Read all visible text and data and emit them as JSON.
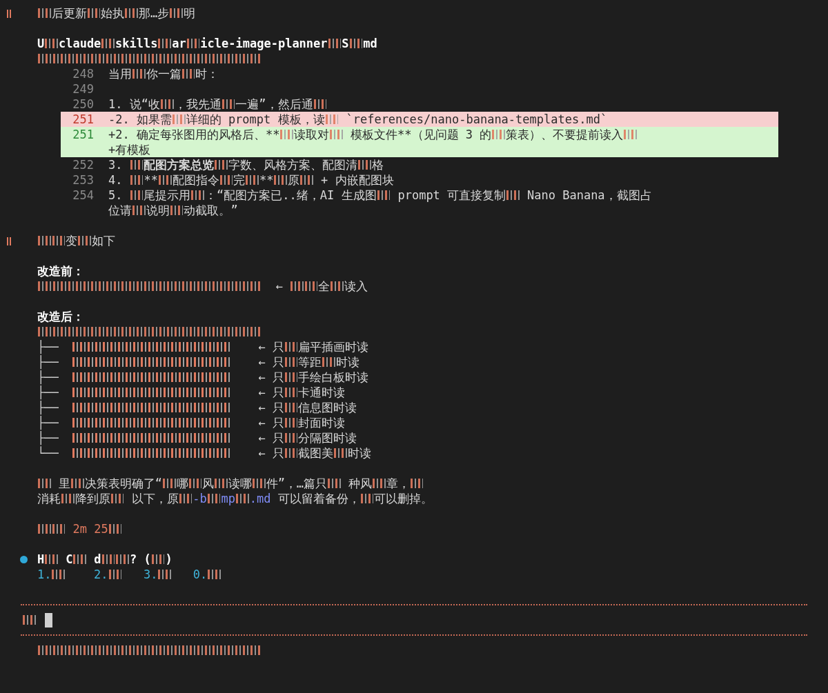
{
  "lines": [
    {
      "kind": "message",
      "segs": [
        {
          "kind": "glitch"
        },
        {
          "kind": "text",
          "text": "后更新"
        },
        {
          "kind": "glitch"
        },
        {
          "kind": "text",
          "text": "始执"
        },
        {
          "kind": "glitch"
        },
        {
          "kind": "text",
          "text": "那…步"
        },
        {
          "kind": "glitch"
        },
        {
          "kind": "text",
          "text": "明"
        }
      ]
    },
    {
      "kind": "blank"
    },
    {
      "kind": "header",
      "segs": [
        {
          "kind": "bold",
          "text": "U"
        },
        {
          "kind": "glitch"
        },
        {
          "kind": "bold",
          "text": "claude"
        },
        {
          "kind": "glitch"
        },
        {
          "kind": "bold",
          "text": "skills"
        },
        {
          "kind": "glitch"
        },
        {
          "kind": "bold",
          "text": "ar"
        },
        {
          "kind": "glitch"
        },
        {
          "kind": "bold",
          "text": "icle-image-planner"
        },
        {
          "kind": "glitch"
        },
        {
          "kind": "bold",
          "text": "S"
        },
        {
          "kind": "glitch"
        },
        {
          "kind": "bold",
          "text": "md"
        }
      ]
    },
    {
      "kind": "plain",
      "segs": [
        {
          "kind": "glitch-run"
        }
      ]
    },
    {
      "kind": "code",
      "number": "248",
      "segs": [
        {
          "kind": "text",
          "text": "当用"
        },
        {
          "kind": "glitch"
        },
        {
          "kind": "text",
          "text": "你一篇"
        },
        {
          "kind": "glitch"
        },
        {
          "kind": "text",
          "text": "时："
        }
      ]
    },
    {
      "kind": "code",
      "number": "249"
    },
    {
      "kind": "code",
      "number": "250",
      "segs": [
        {
          "kind": "text",
          "text": "1. 说“收"
        },
        {
          "kind": "glitch"
        },
        {
          "kind": "text",
          "text": "，我先通"
        },
        {
          "kind": "glitch"
        },
        {
          "kind": "text",
          "text": "一遍”，然后通"
        },
        {
          "kind": "glitch"
        }
      ]
    },
    {
      "kind": "removed",
      "number": "251",
      "segs": [
        {
          "kind": "text",
          "text": "-2. 如果需"
        },
        {
          "kind": "glitch"
        },
        {
          "kind": "text",
          "text": "详细的 prompt 模板，读"
        },
        {
          "kind": "glitch"
        },
        {
          "kind": "text",
          "text": " `references/nano-banana-templates.md`"
        }
      ]
    },
    {
      "kind": "added",
      "number": "251",
      "segs": [
        {
          "kind": "text",
          "text": "+2. 确定每张图用的风格后、**"
        },
        {
          "kind": "glitch"
        },
        {
          "kind": "text",
          "text": "读取对"
        },
        {
          "kind": "glitch"
        },
        {
          "kind": "text",
          "text": " 模板文件**（见问题 3 的"
        },
        {
          "kind": "glitch"
        },
        {
          "kind": "text",
          "text": "策表）、不要提前读入"
        },
        {
          "kind": "glitch"
        }
      ]
    },
    {
      "kind": "added",
      "segs": [
        {
          "kind": "text",
          "text": "+有模板"
        }
      ]
    },
    {
      "kind": "code",
      "number": "252",
      "segs": [
        {
          "kind": "text",
          "text": "3. "
        },
        {
          "kind": "glitch"
        },
        {
          "kind": "text",
          "text": "**配图方案总览**"
        },
        {
          "kind": "glitch"
        },
        {
          "kind": "text",
          "text": "字数、风格方案、配图清"
        },
        {
          "kind": "glitch"
        },
        {
          "kind": "text",
          "text": "格"
        }
      ]
    },
    {
      "kind": "code",
      "number": "253",
      "segs": [
        {
          "kind": "text",
          "text": "4. "
        },
        {
          "kind": "glitch"
        },
        {
          "kind": "text",
          "text": "**"
        },
        {
          "kind": "glitch"
        },
        {
          "kind": "text",
          "text": "配图指令"
        },
        {
          "kind": "glitch"
        },
        {
          "kind": "text",
          "text": "完"
        },
        {
          "kind": "glitch"
        },
        {
          "kind": "text",
          "text": "**"
        },
        {
          "kind": "glitch"
        },
        {
          "kind": "text",
          "text": "原"
        },
        {
          "kind": "glitch"
        },
        {
          "kind": "text",
          "text": " + 内嵌配图块"
        }
      ]
    },
    {
      "kind": "code",
      "number": "254",
      "segs": [
        {
          "kind": "text",
          "text": "5. "
        },
        {
          "kind": "glitch"
        },
        {
          "kind": "text",
          "text": "尾提示用"
        },
        {
          "kind": "glitch"
        },
        {
          "kind": "text",
          "text": "：“配图方案已..绪，AI 生成图"
        },
        {
          "kind": "glitch"
        },
        {
          "kind": "text",
          "text": " prompt 可直接复制"
        },
        {
          "kind": "glitch"
        },
        {
          "kind": "text",
          "text": " Nano Banana，截图占"
        }
      ]
    },
    {
      "kind": "code",
      "segs": [
        {
          "kind": "text",
          "text": "位请"
        },
        {
          "kind": "glitch"
        },
        {
          "kind": "text",
          "text": "说明"
        },
        {
          "kind": "glitch"
        },
        {
          "kind": "text",
          "text": "动截取。”"
        }
      ]
    },
    {
      "kind": "blank"
    },
    {
      "kind": "message",
      "segs": [
        {
          "kind": "glitch"
        },
        {
          "kind": "glitch"
        },
        {
          "kind": "text",
          "text": "变"
        },
        {
          "kind": "glitch"
        },
        {
          "kind": "text",
          "text": "如下"
        }
      ]
    },
    {
      "kind": "blank"
    },
    {
      "kind": "plain",
      "segs": [
        {
          "kind": "bold",
          "text": "改造前："
        }
      ]
    },
    {
      "kind": "plain",
      "segs": [
        {
          "kind": "glitch-run"
        },
        {
          "kind": "text",
          "text": "  ← "
        },
        {
          "kind": "glitch"
        },
        {
          "kind": "glitch"
        },
        {
          "kind": "text",
          "text": "全"
        },
        {
          "kind": "glitch"
        },
        {
          "kind": "text",
          "text": "读入"
        }
      ]
    },
    {
      "kind": "blank"
    },
    {
      "kind": "plain",
      "segs": [
        {
          "kind": "bold",
          "text": "改造后："
        }
      ]
    },
    {
      "kind": "plain",
      "segs": [
        {
          "kind": "glitch-run"
        }
      ]
    },
    {
      "kind": "tree",
      "branch": "├──",
      "segs": [
        {
          "kind": "text",
          "text": "← 只"
        },
        {
          "kind": "glitch"
        },
        {
          "kind": "text",
          "text": "扁平插画时读"
        }
      ]
    },
    {
      "kind": "tree",
      "branch": "├──",
      "segs": [
        {
          "kind": "text",
          "text": "← 只"
        },
        {
          "kind": "glitch"
        },
        {
          "kind": "text",
          "text": "等距"
        },
        {
          "kind": "glitch"
        },
        {
          "kind": "text",
          "text": "时读"
        }
      ]
    },
    {
      "kind": "tree",
      "branch": "├──",
      "segs": [
        {
          "kind": "text",
          "text": "← 只"
        },
        {
          "kind": "glitch"
        },
        {
          "kind": "text",
          "text": "手绘白板时读"
        }
      ]
    },
    {
      "kind": "tree",
      "branch": "├──",
      "segs": [
        {
          "kind": "text",
          "text": "← 只"
        },
        {
          "kind": "glitch"
        },
        {
          "kind": "text",
          "text": "卡通时读"
        }
      ]
    },
    {
      "kind": "tree",
      "branch": "├──",
      "segs": [
        {
          "kind": "text",
          "text": "← 只"
        },
        {
          "kind": "glitch"
        },
        {
          "kind": "text",
          "text": "信息图时读"
        }
      ]
    },
    {
      "kind": "tree",
      "branch": "├──",
      "segs": [
        {
          "kind": "text",
          "text": "← 只"
        },
        {
          "kind": "glitch"
        },
        {
          "kind": "text",
          "text": "封面时读"
        }
      ]
    },
    {
      "kind": "tree",
      "branch": "├──",
      "segs": [
        {
          "kind": "text",
          "text": "← 只"
        },
        {
          "kind": "glitch"
        },
        {
          "kind": "text",
          "text": "分隔图时读"
        }
      ]
    },
    {
      "kind": "tree",
      "branch": "└──",
      "segs": [
        {
          "kind": "text",
          "text": "← 只"
        },
        {
          "kind": "glitch"
        },
        {
          "kind": "text",
          "text": "截图美"
        },
        {
          "kind": "glitch"
        },
        {
          "kind": "text",
          "text": "时读"
        }
      ]
    },
    {
      "kind": "blank"
    },
    {
      "kind": "plain",
      "segs": [
        {
          "kind": "glitch"
        },
        {
          "kind": "text",
          "text": " 里"
        },
        {
          "kind": "glitch"
        },
        {
          "kind": "text",
          "text": "决策表明确了“"
        },
        {
          "kind": "glitch"
        },
        {
          "kind": "text",
          "text": "哪"
        },
        {
          "kind": "glitch"
        },
        {
          "kind": "text",
          "text": "风"
        },
        {
          "kind": "glitch"
        },
        {
          "kind": "text",
          "text": "读哪"
        },
        {
          "kind": "glitch"
        },
        {
          "kind": "text",
          "text": "件”，…篇只"
        },
        {
          "kind": "glitch"
        },
        {
          "kind": "text",
          "text": " 种风"
        },
        {
          "kind": "glitch"
        },
        {
          "kind": "text",
          "text": "章，"
        },
        {
          "kind": "glitch"
        }
      ]
    },
    {
      "kind": "plain",
      "segs": [
        {
          "kind": "text",
          "text": "消耗"
        },
        {
          "kind": "glitch"
        },
        {
          "kind": "text",
          "text": "降到原"
        },
        {
          "kind": "glitch"
        },
        {
          "kind": "text",
          "text": " 以下，原"
        },
        {
          "kind": "glitch"
        },
        {
          "kind": "link",
          "text": "-b"
        },
        {
          "kind": "glitch"
        },
        {
          "kind": "link",
          "text": "mp"
        },
        {
          "kind": "glitch"
        },
        {
          "kind": "link",
          "text": ".md"
        },
        {
          "kind": "text",
          "text": " 可以留着备份，"
        },
        {
          "kind": "glitch"
        },
        {
          "kind": "text",
          "text": "可以删掉。"
        }
      ]
    },
    {
      "kind": "blank"
    },
    {
      "kind": "timer",
      "segs": [
        {
          "kind": "glitch"
        },
        {
          "kind": "glitch"
        },
        {
          "kind": "warm",
          "text": " 2m 25"
        },
        {
          "kind": "glitch"
        }
      ]
    },
    {
      "kind": "blank"
    },
    {
      "kind": "question",
      "segs": [
        {
          "kind": "bold",
          "text": "H"
        },
        {
          "kind": "glitch"
        },
        {
          "kind": "bold",
          "text": " C"
        },
        {
          "kind": "glitch"
        },
        {
          "kind": "bold",
          "text": " d"
        },
        {
          "kind": "glitch"
        },
        {
          "kind": "glitch"
        },
        {
          "kind": "bold",
          "text": "? ("
        },
        {
          "kind": "glitch"
        },
        {
          "kind": "bold",
          "text": ")"
        }
      ]
    },
    {
      "kind": "plain",
      "segs": [
        {
          "kind": "option",
          "text": "1."
        },
        {
          "kind": "glitch"
        },
        {
          "kind": "option",
          "text": "    2."
        },
        {
          "kind": "glitch"
        },
        {
          "kind": "option",
          "text": "   3."
        },
        {
          "kind": "glitch"
        },
        {
          "kind": "option",
          "text": "   0."
        },
        {
          "kind": "glitch"
        }
      ]
    },
    {
      "kind": "blank"
    },
    {
      "kind": "rule"
    },
    {
      "kind": "prompt",
      "segs": [
        {
          "kind": "glitch"
        }
      ]
    },
    {
      "kind": "rule"
    },
    {
      "kind": "footer",
      "segs": [
        {
          "kind": "glitch-run"
        }
      ]
    }
  ]
}
